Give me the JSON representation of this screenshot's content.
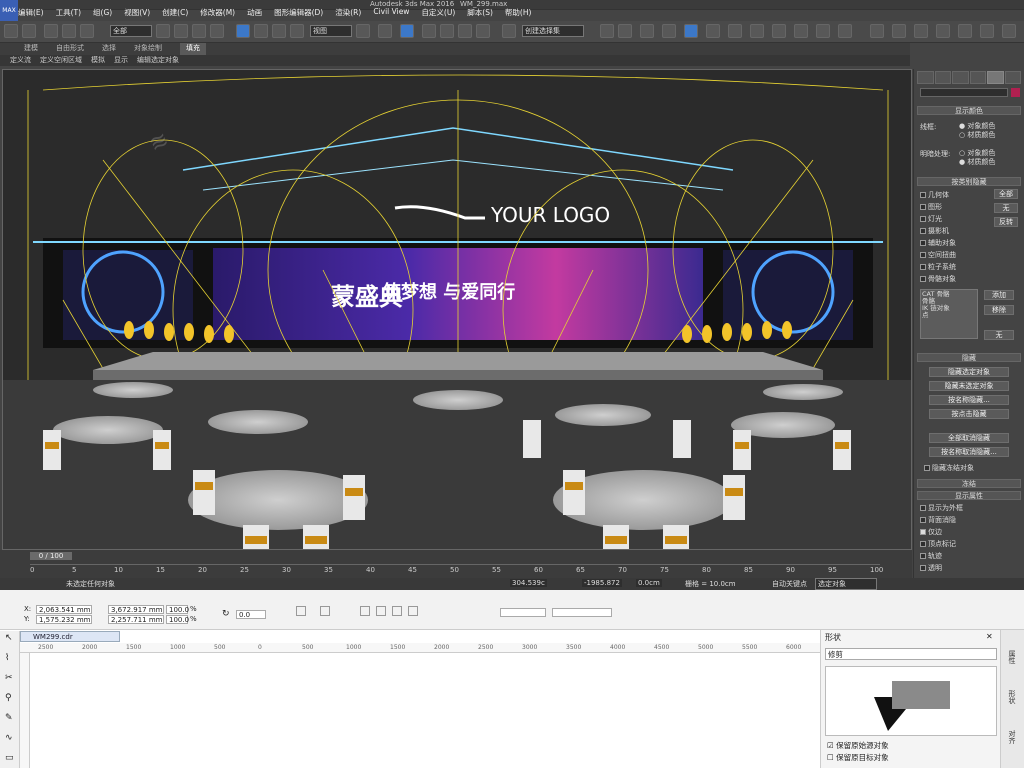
{
  "max": {
    "title": "Autodesk 3ds Max 2016",
    "file": "WM_299.max",
    "logo": "MAX",
    "menu": [
      "编辑(E)",
      "工具(T)",
      "组(G)",
      "视图(V)",
      "创建(C)",
      "修改器(M)",
      "动画",
      "图形编辑器(D)",
      "渲染(R)",
      "Civil View",
      "自定义(U)",
      "脚本(S)",
      "帮助(H)"
    ],
    "toolbar": {
      "filter": "全部",
      "view": "视图",
      "selset": "创建选择集"
    },
    "ribbon": [
      "建模",
      "自由形式",
      "选择",
      "对象绘制",
      "填充"
    ],
    "ribbon_active": "填充",
    "subribbon": [
      "定义流",
      "定义空闲区域",
      "模拟",
      "显示",
      "编辑选定对象"
    ],
    "viewport": {
      "logo_text": "YOUR LOGO",
      "screen_text_main": "蒙盛典",
      "screen_text_sub": "筑梦想 与爱同行"
    },
    "timeline": {
      "frame": "0 / 100",
      "ticks": [
        "0",
        "5",
        "10",
        "15",
        "20",
        "25",
        "30",
        "35",
        "40",
        "45",
        "50",
        "55",
        "60",
        "65",
        "70",
        "75",
        "80",
        "85",
        "90",
        "95",
        "100"
      ]
    },
    "status": {
      "selection": "未选定任何对象",
      "x": "304.539c",
      "y": "-1985.872",
      "z": "0.0cm",
      "grid": "栅格 = 10.0cm",
      "autokey": "自动关键点",
      "selected": "选定对象"
    },
    "cmd": {
      "display_color_hd": "显示颜色",
      "wireframe_label": "线框:",
      "shaded_label": "明暗处理:",
      "radio_obj": "对象颜色",
      "radio_mat": "材质颜色",
      "hide_by_cat_hd": "按类别隐藏",
      "categories": [
        "几何体",
        "图形",
        "灯光",
        "摄影机",
        "辅助对象",
        "空间扭曲",
        "粒子系统",
        "骨骼对象"
      ],
      "btn_all": "全部",
      "btn_none": "无",
      "btn_invert": "反转",
      "list": [
        "CAT 骨骼",
        "骨骼",
        "IK 链对象",
        "点"
      ],
      "btn_add": "添加",
      "btn_remove": "移除",
      "btn_none2": "无",
      "hide_hd": "隐藏",
      "hide_buttons": [
        "隐藏选定对象",
        "隐藏未选定对象",
        "按名称隐藏...",
        "按点击隐藏",
        "全部取消隐藏",
        "按名称取消隐藏...",
        "隐藏冻结对象"
      ],
      "freeze_hd": "冻结",
      "disp_props_hd": "显示属性",
      "disp_props": [
        "显示为外框",
        "背面消隐",
        "仅边",
        "顶点标记",
        "轨迹",
        "透明"
      ]
    }
  },
  "cdr": {
    "x": "2,063.541 mm",
    "y": "1,575.232 mm",
    "w": "3,672.917 mm",
    "h": "2,257.711 mm",
    "sx": "100.0",
    "sy": "100.0",
    "pct": "%",
    "angle": "0.0",
    "file": "WM299.cdr",
    "ruler": [
      "2500",
      "2000",
      "1500",
      "1000",
      "500",
      "0",
      "500",
      "1000",
      "1500",
      "2000",
      "2500",
      "3000",
      "3500",
      "4000",
      "4500",
      "5000",
      "5500",
      "6000"
    ],
    "panel_title": "形状",
    "mode": "修剪",
    "opt1": "保留原始源对象",
    "opt2": "保留原目标对象",
    "docker": [
      "属性",
      "形状",
      "对齐"
    ]
  }
}
